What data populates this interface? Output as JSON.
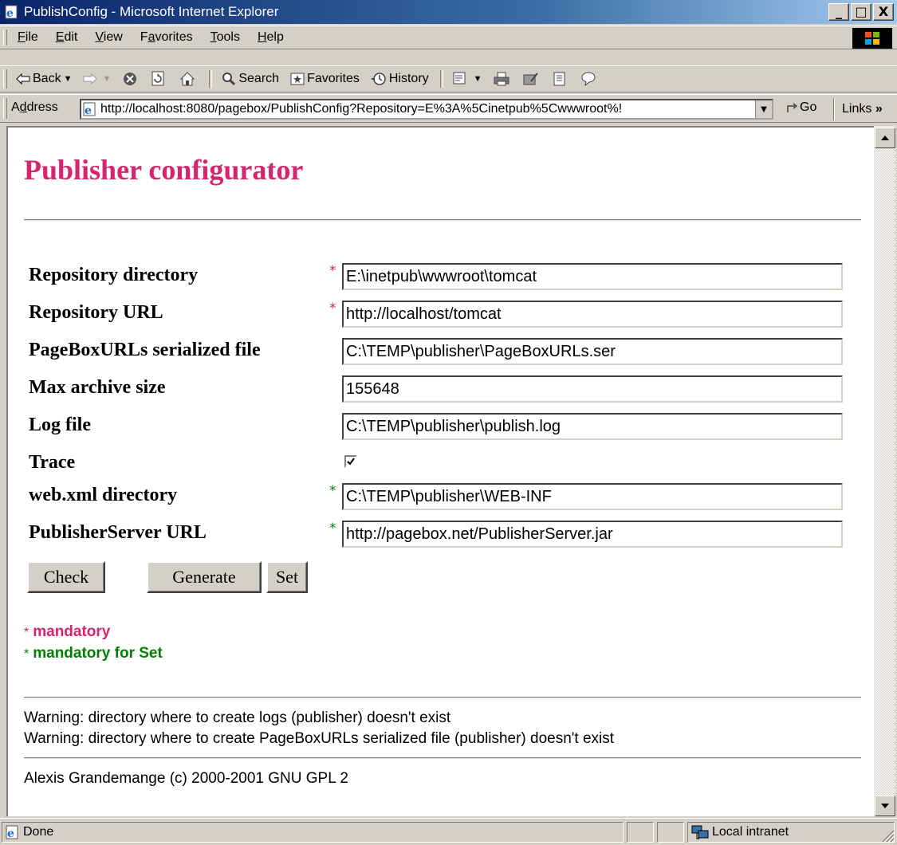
{
  "window": {
    "title": "PublishConfig - Microsoft Internet Explorer",
    "controls": {
      "minimize": "_",
      "maximize": "□",
      "close": "X"
    }
  },
  "menubar": {
    "items": [
      {
        "accel": "F",
        "rest": "ile"
      },
      {
        "accel": "E",
        "rest": "dit"
      },
      {
        "accel": "V",
        "rest": "iew"
      },
      {
        "pre": "F",
        "accel": "a",
        "rest": "vorites"
      },
      {
        "accel": "T",
        "rest": "ools"
      },
      {
        "accel": "H",
        "rest": "elp"
      }
    ]
  },
  "toolbar": {
    "back_label": "Back",
    "search_label": "Search",
    "favorites_label": "Favorites",
    "history_label": "History"
  },
  "address": {
    "label_pre": "A",
    "label_accel": "d",
    "label_rest": "dress",
    "url": "http://localhost:8080/pagebox/PublishConfig?Repository=E%3A%5Cinetpub%5Cwwwroot%!",
    "go_label": "Go",
    "links_label": "Links"
  },
  "page": {
    "title": "Publisher configurator",
    "fields": [
      {
        "label": "Repository directory",
        "mark": "*",
        "mark_color": "red",
        "value": "E:\\inetpub\\wwwroot\\tomcat"
      },
      {
        "label": "Repository URL",
        "mark": "*",
        "mark_color": "red",
        "value": "http://localhost/tomcat"
      },
      {
        "label": "PageBoxURLs serialized file",
        "mark": "",
        "mark_color": "",
        "value": "C:\\TEMP\\publisher\\PageBoxURLs.ser"
      },
      {
        "label": "Max archive size",
        "mark": "",
        "mark_color": "",
        "value": "155648"
      },
      {
        "label": "Log file",
        "mark": "",
        "mark_color": "",
        "value": "C:\\TEMP\\publisher\\publish.log"
      },
      {
        "label": "Trace",
        "type": "checkbox",
        "checked": true
      },
      {
        "label": "web.xml directory",
        "mark": "*",
        "mark_color": "green",
        "value": "C:\\TEMP\\publisher\\WEB-INF"
      },
      {
        "label": "PublisherServer URL",
        "mark": "*",
        "mark_color": "green",
        "value": "http://pagebox.net/PublisherServer.jar"
      }
    ],
    "buttons": {
      "check": "Check",
      "generate": "Generate",
      "set": "Set"
    },
    "legend": {
      "star": "*",
      "mandatory": "mandatory",
      "mandatory_for_set": "mandatory for Set"
    },
    "warnings": [
      "Warning: directory where to create logs (publisher) doesn't exist",
      "Warning: directory where to create PageBoxURLs serialized file (publisher) doesn't exist"
    ],
    "footer": "Alexis Grandemange (c) 2000-2001 GNU GPL 2"
  },
  "statusbar": {
    "status": "Done",
    "zone": "Local intranet"
  },
  "colors": {
    "title_accent": "#d6246e",
    "mandatory_red": "#d6246e",
    "mandatory_green": "#008000",
    "chrome": "#d4d0c8"
  }
}
